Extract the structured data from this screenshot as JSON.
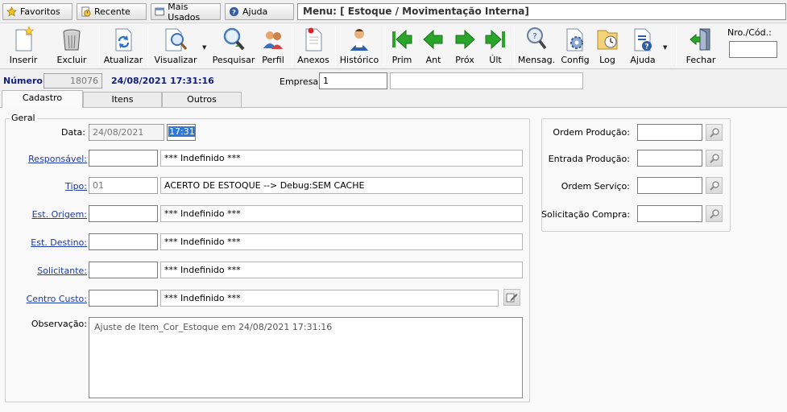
{
  "quickbar": {
    "favoritos": "Favoritos",
    "recente": "Recente",
    "mais_usados": "Mais Usados",
    "ajuda": "Ajuda",
    "menu_path": "Menu: [ Estoque / Movimentação Interna]"
  },
  "toolbar": {
    "inserir": "Inserir",
    "excluir": "Excluir",
    "atualizar": "Atualizar",
    "visualizar": "Visualizar",
    "pesquisar": "Pesquisar",
    "perfil": "Perfil",
    "anexos": "Anexos",
    "historico": "Histórico",
    "prim": "Prim",
    "ant": "Ant",
    "prox": "Próx",
    "ult": "Últ",
    "mensag": "Mensag.",
    "config": "Config",
    "log": "Log",
    "ajuda": "Ajuda",
    "fechar": "Fechar",
    "nro_cod_label": "Nro./Cód.:",
    "nro_cod_value": ""
  },
  "header": {
    "numero_label": "Número:",
    "numero_value": "18076",
    "datetime": "24/08/2021 17:31:16",
    "empresa_label": "Empresa:",
    "empresa_code": "1",
    "empresa_name": ""
  },
  "tabs": [
    "Cadastro",
    "Itens",
    "Outros"
  ],
  "form": {
    "group_title": "Geral",
    "data_label": "Data:",
    "data_value": "24/08/2021",
    "hora_value": "17:31",
    "responsavel_label": "Responsável:",
    "responsavel_code": "",
    "responsavel_desc": "*** Indefinido ***",
    "tipo_label": "Tipo:",
    "tipo_code": "01",
    "tipo_desc": "ACERTO DE ESTOQUE   --> Debug:SEM CACHE",
    "est_origem_label": "Est. Origem:",
    "est_origem_code": "",
    "est_origem_desc": "*** Indefinido ***",
    "est_destino_label": "Est. Destino:",
    "est_destino_code": "",
    "est_destino_desc": "*** Indefinido ***",
    "solicitante_label": "Solicitante:",
    "solicitante_code": "",
    "solicitante_desc": "*** Indefinido ***",
    "centro_custo_label": "Centro Custo:",
    "centro_custo_code": "",
    "centro_custo_desc": "*** Indefinido ***",
    "observacao_label": "Observação:",
    "observacao_value": "Ajuste de Item_Cor_Estoque em 24/08/2021 17:31:16"
  },
  "side": {
    "ordem_producao_label": "Ordem Produção:",
    "ordem_producao_value": "",
    "entrada_producao_label": "Entrada Produção:",
    "entrada_producao_value": "",
    "ordem_servico_label": "Ordem Serviço:",
    "ordem_servico_value": "",
    "solicitacao_compra_label": "Solicitação Compra:",
    "solicitacao_compra_value": ""
  },
  "icons": {
    "favoritos": "star-icon",
    "recente": "history-icon",
    "mais_usados": "window-icon",
    "ajuda": "help-icon",
    "lookup": "magnifier-icon",
    "edit": "edit-icon"
  },
  "colors": {
    "link": "#1c3aa8",
    "header_value": "#14217a",
    "nav_arrow": "#2aa52a",
    "highlight": "#3079d6"
  }
}
